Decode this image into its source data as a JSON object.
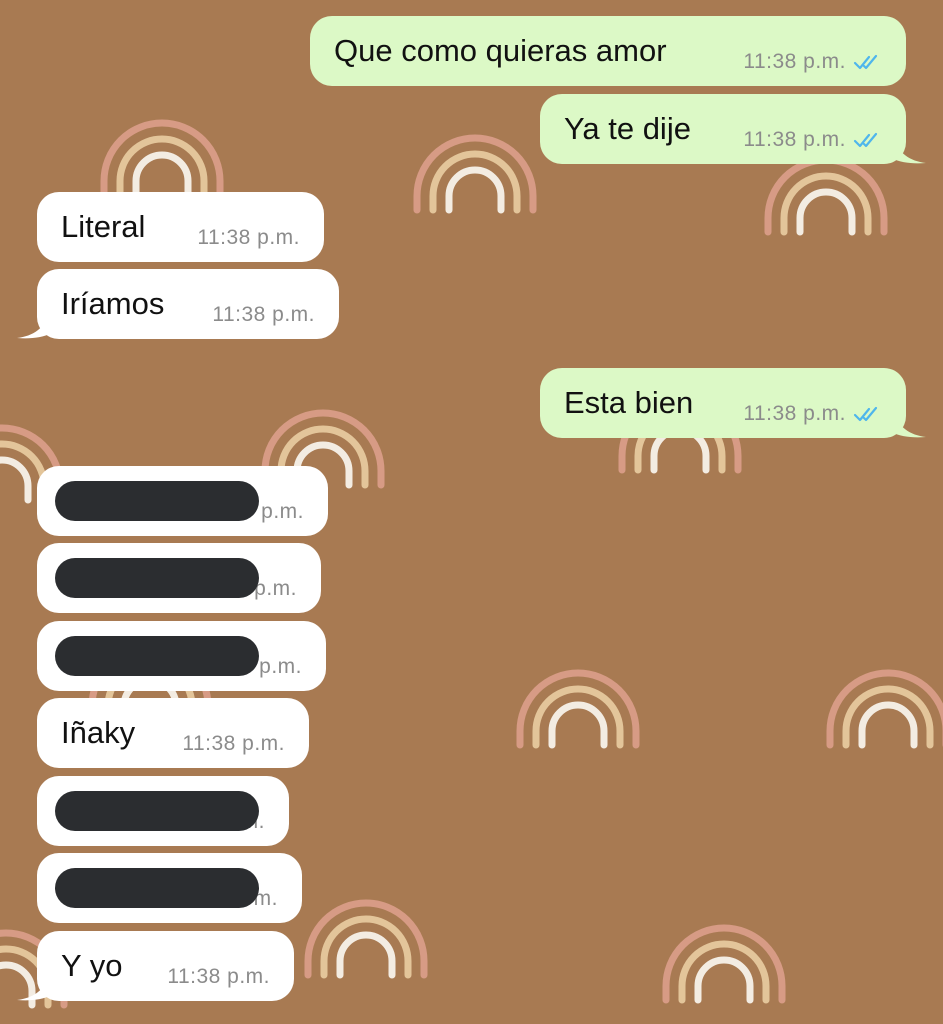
{
  "messages": [
    {
      "direction": "out",
      "text": "Que como quieras amor",
      "time": "11:38 p.m.",
      "status": "read-double-check-icon"
    },
    {
      "direction": "out",
      "text": "Ya te dije",
      "time": "11:38 p.m.",
      "status": "read-double-check-icon"
    },
    {
      "direction": "in",
      "text": "Literal",
      "time": "11:38 p.m."
    },
    {
      "direction": "in",
      "text": "Iríamos",
      "time": "11:38 p.m."
    },
    {
      "direction": "out",
      "text": "Esta bien",
      "time": "11:38 p.m.",
      "status": "read-double-check-icon"
    },
    {
      "direction": "in",
      "text": "",
      "time": "p.m.",
      "redacted": true
    },
    {
      "direction": "in",
      "text": "",
      "time": "p.m.",
      "redacted": true
    },
    {
      "direction": "in",
      "text": "",
      "time": "p.m.",
      "redacted": true
    },
    {
      "direction": "in",
      "text": "Iñaky",
      "time": "11:38 p.m."
    },
    {
      "direction": "in",
      "text": "",
      "time": "m.",
      "redacted": true
    },
    {
      "direction": "in",
      "text": "",
      "time": "m.",
      "redacted": true
    },
    {
      "direction": "in",
      "text": "Y yo",
      "time": "11:38 p.m."
    }
  ],
  "colors": {
    "wallpaper": "#a87a52",
    "outgoing_bubble": "#dcf9c6",
    "incoming_bubble": "#ffffff",
    "read_ticks": "#4fb6ec",
    "redaction": "#2b2d30",
    "rainbow_arcs": [
      "#d79b85",
      "#e3c59a",
      "#f3ece2"
    ]
  },
  "wallpaper_motif": "rainbow-icon"
}
